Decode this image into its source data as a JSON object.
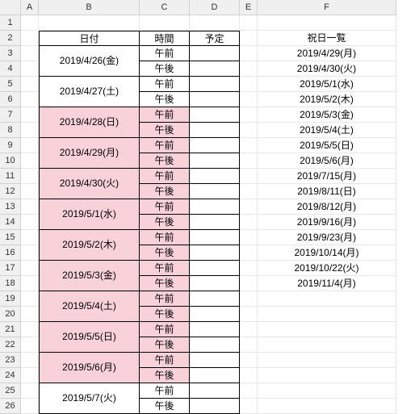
{
  "columns": [
    "A",
    "B",
    "C",
    "D",
    "E",
    "F"
  ],
  "row_count": 26,
  "headers": {
    "date": "日付",
    "time": "時間",
    "plan": "予定",
    "holiday_list": "祝日一覧"
  },
  "time_labels": {
    "am": "午前",
    "pm": "午後"
  },
  "schedule": [
    {
      "date": "2019/4/26(金)",
      "highlight": false
    },
    {
      "date": "2019/4/27(土)",
      "highlight": false
    },
    {
      "date": "2019/4/28(日)",
      "highlight": true
    },
    {
      "date": "2019/4/29(月)",
      "highlight": true
    },
    {
      "date": "2019/4/30(火)",
      "highlight": true
    },
    {
      "date": "2019/5/1(水)",
      "highlight": true
    },
    {
      "date": "2019/5/2(木)",
      "highlight": true
    },
    {
      "date": "2019/5/3(金)",
      "highlight": true
    },
    {
      "date": "2019/5/4(土)",
      "highlight": true
    },
    {
      "date": "2019/5/5(日)",
      "highlight": true
    },
    {
      "date": "2019/5/6(月)",
      "highlight": true
    },
    {
      "date": "2019/5/7(火)",
      "highlight": false
    }
  ],
  "holidays": [
    "2019/4/29(月)",
    "2019/4/30(火)",
    "2019/5/1(水)",
    "2019/5/2(木)",
    "2019/5/3(金)",
    "2019/5/4(土)",
    "2019/5/5(日)",
    "2019/5/6(月)",
    "2019/7/15(月)",
    "2019/8/11(日)",
    "2019/8/12(月)",
    "2019/9/16(月)",
    "2019/9/23(月)",
    "2019/10/14(月)",
    "2019/10/22(火)",
    "2019/11/4(月)"
  ]
}
